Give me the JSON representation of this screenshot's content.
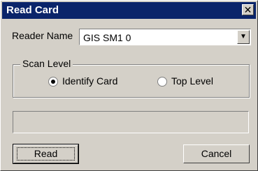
{
  "window": {
    "title": "Read Card"
  },
  "reader": {
    "label": "Reader Name",
    "selected": "GIS SM1 0"
  },
  "scan_level": {
    "legend": "Scan Level",
    "options": [
      {
        "label": "Identify Card",
        "checked": true
      },
      {
        "label": "Top Level",
        "checked": false
      }
    ]
  },
  "progress": {
    "value": 0
  },
  "buttons": {
    "read": "Read",
    "cancel": "Cancel"
  },
  "icons": {
    "close": "close-icon",
    "dropdown": "chevron-down-icon"
  }
}
